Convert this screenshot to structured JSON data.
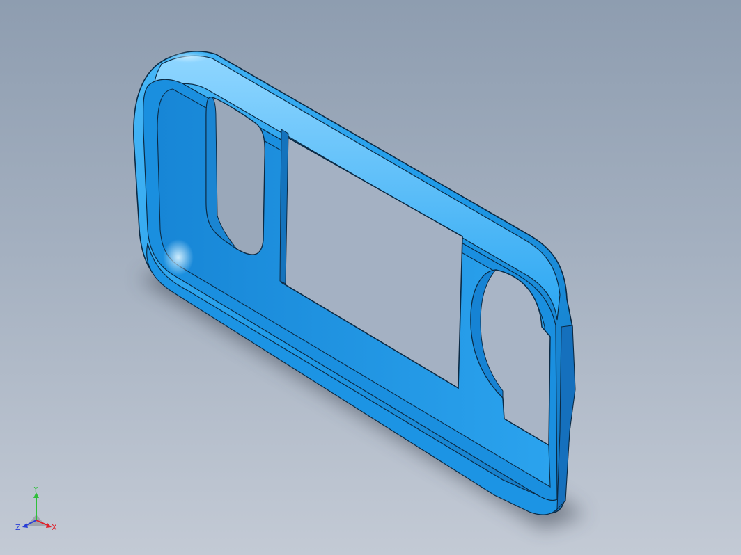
{
  "viewport": {
    "model_name": "bezel-frame",
    "shading": "shaded-with-edges",
    "model_color": "#1e9ae8",
    "edge_color": "#0b2a44",
    "background_top": "#8e9db0",
    "background_bottom": "#c3cad5"
  },
  "triad": {
    "x_label": "X",
    "y_label": "Y",
    "z_label": "Z",
    "x_color": "#e0202a",
    "y_color": "#2fbf3a",
    "z_color": "#2a3fd6"
  }
}
